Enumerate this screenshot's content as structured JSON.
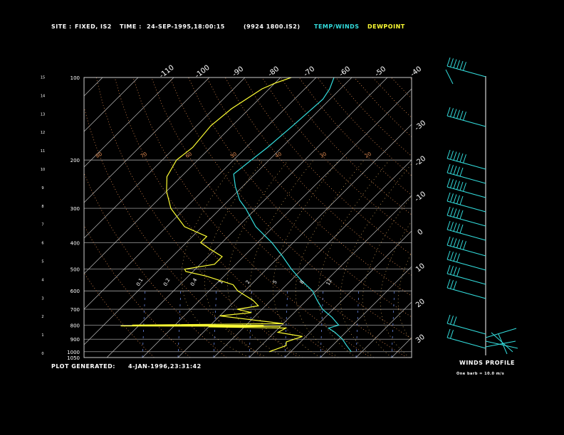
{
  "header": {
    "site_label": "SITE :",
    "site_value": "FIXED, IS2",
    "time_label": "TIME :",
    "time_value": "24-SEP-1995,18:00:15",
    "file_id": "(9924 1800.IS2)",
    "temp_legend": "TEMP/WINDS",
    "dew_legend": "DEWPOINT"
  },
  "footer": {
    "generated_label": "PLOT GENERATED:",
    "generated_value": "4-JAN-1996,23:31:42",
    "winds_label": "WINDS PROFILE",
    "barbs_note": "One barb = 10.0 m/s"
  },
  "colors": {
    "temp": "#33dddd",
    "dewpoint": "#ffff33",
    "isotherm": "#bbbbbb",
    "pressure_line": "#bbbbbb",
    "dry_adiabat": "#e08a50",
    "moist_adiabat": "#e0b060",
    "mixing_ratio": "#7799ff"
  },
  "chart_data": {
    "type": "line",
    "pressure_ticks": [
      100,
      200,
      300,
      400,
      500,
      600,
      700,
      800,
      900,
      1000,
      1050
    ],
    "height_ticks": [
      0,
      1,
      2,
      3,
      4,
      5,
      6,
      7,
      8,
      9,
      10,
      11,
      12,
      13,
      14,
      15
    ],
    "isotherm_labels_top": [
      -110,
      -100,
      -90,
      -80,
      -70,
      -60,
      -50,
      -40
    ],
    "isotherm_labels_right": [
      -30,
      -20,
      -10,
      0,
      10,
      20,
      30
    ],
    "dry_adiabat_labels": [
      80,
      70,
      60,
      50,
      40,
      30,
      20
    ],
    "moist_adiabat_labels": [
      0.1,
      0.2,
      0.4,
      1.0,
      2.0,
      5.0,
      8.0,
      12.0
    ],
    "series": [
      {
        "name": "TEMP/WINDS",
        "points": [
          [
            100,
            -65
          ],
          [
            110,
            -63
          ],
          [
            120,
            -62
          ],
          [
            150,
            -63
          ],
          [
            180,
            -64
          ],
          [
            200,
            -65
          ],
          [
            225,
            -66
          ],
          [
            250,
            -62
          ],
          [
            280,
            -57
          ],
          [
            300,
            -53
          ],
          [
            350,
            -45
          ],
          [
            400,
            -36
          ],
          [
            450,
            -29
          ],
          [
            500,
            -23
          ],
          [
            550,
            -17
          ],
          [
            600,
            -11
          ],
          [
            650,
            -7
          ],
          [
            700,
            -3
          ],
          [
            750,
            2
          ],
          [
            800,
            6
          ],
          [
            820,
            4
          ],
          [
            850,
            7
          ],
          [
            900,
            11
          ],
          [
            950,
            14
          ],
          [
            1000,
            17
          ]
        ]
      },
      {
        "name": "DEWPOINT",
        "points": [
          [
            100,
            -77
          ],
          [
            105,
            -80
          ],
          [
            110,
            -82
          ],
          [
            130,
            -85
          ],
          [
            150,
            -86
          ],
          [
            180,
            -85
          ],
          [
            200,
            -86
          ],
          [
            230,
            -84
          ],
          [
            260,
            -80
          ],
          [
            300,
            -74
          ],
          [
            350,
            -65
          ],
          [
            380,
            -56
          ],
          [
            400,
            -56
          ],
          [
            420,
            -52
          ],
          [
            450,
            -46
          ],
          [
            480,
            -46
          ],
          [
            500,
            -53
          ],
          [
            510,
            -52
          ],
          [
            530,
            -45
          ],
          [
            570,
            -35
          ],
          [
            600,
            -32
          ],
          [
            650,
            -25
          ],
          [
            680,
            -22
          ],
          [
            700,
            -27
          ],
          [
            720,
            -22
          ],
          [
            740,
            -30
          ],
          [
            760,
            -22
          ],
          [
            790,
            -10
          ],
          [
            800,
            -52
          ],
          [
            802,
            -15
          ],
          [
            805,
            -55
          ],
          [
            808,
            -10
          ],
          [
            812,
            -30
          ],
          [
            820,
            -8
          ],
          [
            850,
            -9
          ],
          [
            880,
            -1
          ],
          [
            920,
            -4
          ],
          [
            950,
            -3
          ],
          [
            1000,
            -6
          ]
        ]
      }
    ]
  }
}
